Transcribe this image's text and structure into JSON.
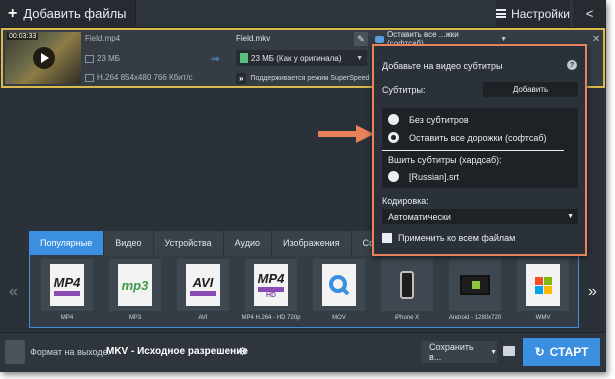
{
  "toolbar": {
    "add_files_label": "Добавить файлы",
    "settings_label": "Настройки"
  },
  "file": {
    "thumb_time": "00:03:33",
    "source_name": "Field.mp4",
    "source_size": "23 МБ",
    "source_info": "H.264 854x480 766 Кбит/с",
    "output_name": "Field.mkv",
    "output_size": "23 МБ (Как у оригинала)",
    "speed_text": "Поддерживается режим SuperSpeed",
    "subs_selected": "Оставить все ...жки (софтсаб)"
  },
  "popup": {
    "title": "Добавьте на видео субтитры",
    "subs_label": "Субтитры:",
    "add_label": "Добавить",
    "options": [
      "Без субтитров",
      "Оставить все дорожки (софтсаб)"
    ],
    "selected_option": 1,
    "burn_label": "Вшить субтитры (хардсаб):",
    "burn_file": "[Russian].srt",
    "encoding_label": "Кодировка:",
    "encoding_value": "Автоматически",
    "apply_all_label": "Применить ко всем файлам"
  },
  "tabs": [
    "Популярные",
    "Видео",
    "Устройства",
    "Аудио",
    "Изображения",
    "Сох"
  ],
  "active_tab": 0,
  "formats": [
    {
      "label": "MP4",
      "icon": "mp4-icon"
    },
    {
      "label": "MP3",
      "icon": "mp3-icon"
    },
    {
      "label": "AVI",
      "icon": "avi-icon"
    },
    {
      "label": "MP4 H.264 - HD 720p",
      "icon": "mp4-hd-icon"
    },
    {
      "label": "MOV",
      "icon": "quicktime-icon"
    },
    {
      "label": "iPhone X",
      "icon": "iphone-icon"
    },
    {
      "label": "Android - 1280x720",
      "icon": "android-tablet-icon"
    },
    {
      "label": "WMV",
      "icon": "windows-icon"
    }
  ],
  "format_icon_text": {
    "mp4": "MP4",
    "mp3": "mp3",
    "avi": "AVI",
    "hd": "HD"
  },
  "bottom": {
    "output_label": "Формат на выходе:",
    "output_value": "MKV - Исходное разрешение",
    "save_label": "Сохранить в...",
    "start_label": "СТАРТ"
  },
  "colors": {
    "accent": "#3b8fe0",
    "highlight": "#e8825a",
    "file_border": "#d9b94c"
  }
}
